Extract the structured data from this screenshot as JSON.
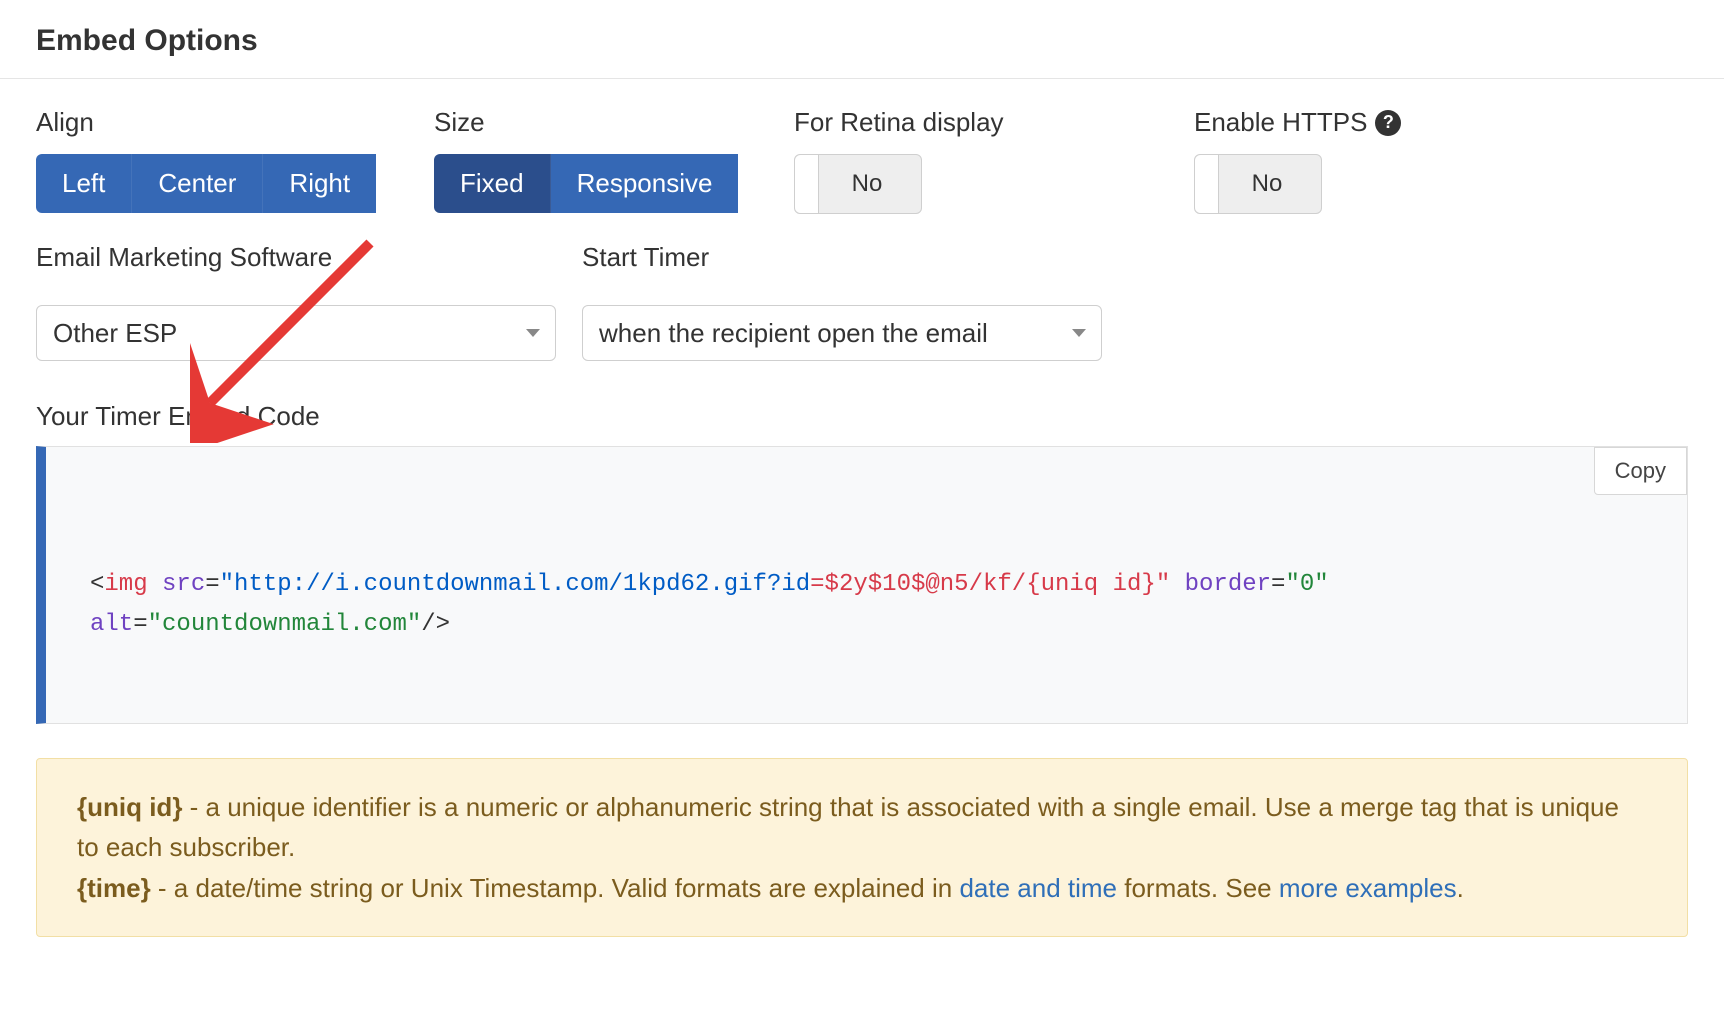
{
  "header": {
    "title": "Embed Options"
  },
  "align": {
    "label": "Align",
    "options": {
      "left": "Left",
      "center": "Center",
      "right": "Right"
    }
  },
  "size": {
    "label": "Size",
    "options": {
      "fixed": "Fixed",
      "responsive": "Responsive"
    },
    "active": "fixed"
  },
  "retina": {
    "label": "For Retina display",
    "value": "No"
  },
  "https": {
    "label": "Enable HTTPS",
    "value": "No"
  },
  "esp": {
    "label": "Email Marketing Software",
    "selected": "Other ESP"
  },
  "start_timer": {
    "label": "Start Timer",
    "selected": "when the recipient open the email"
  },
  "embed": {
    "label": "Your Timer Embed Code",
    "copy": "Copy",
    "code": {
      "tag": "img",
      "src_attr": "src",
      "url_plain": "\"http://i.countdownmail.com/1kpd62.gif?id",
      "url_var": "=$2y$10$@n5/kf/{uniq id}\"",
      "border_attr": "border",
      "border_val": "\"0\"",
      "alt_attr": "alt",
      "alt_val": "\"countdownmail.com\"",
      "slashgt": "/>"
    }
  },
  "info": {
    "uniq_label": "{uniq id}",
    "uniq_text": " - a unique identifier is a numeric or alphanumeric string that is associated with a single email. Use a merge tag that is unique to each subscriber.",
    "time_label": "{time}",
    "time_text_1": " - a date/time string or Unix Timestamp. Valid formats are explained in ",
    "time_link_1": "date and time",
    "time_text_2": " formats. See ",
    "time_link_2": "more examples",
    "time_text_3": "."
  }
}
